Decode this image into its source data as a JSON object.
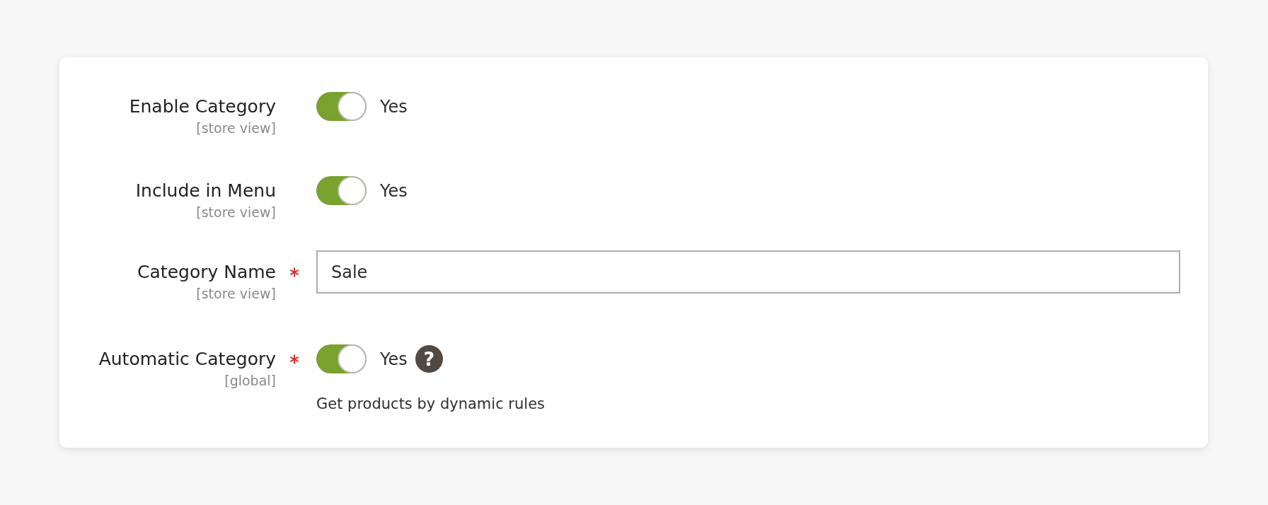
{
  "form": {
    "fields": [
      {
        "kind": "toggle",
        "label": "Enable Category",
        "scope": "[store view]",
        "required": false,
        "on": true,
        "state_text": "Yes"
      },
      {
        "kind": "toggle",
        "label": "Include in Menu",
        "scope": "[store view]",
        "required": false,
        "on": true,
        "state_text": "Yes"
      },
      {
        "kind": "text",
        "label": "Category Name",
        "scope": "[store view]",
        "required": true,
        "value": "Sale"
      },
      {
        "kind": "toggle",
        "label": "Automatic Category",
        "scope": "[global]",
        "required": true,
        "on": true,
        "state_text": "Yes",
        "help_icon": "?",
        "note": "Get products by dynamic rules"
      }
    ]
  }
}
